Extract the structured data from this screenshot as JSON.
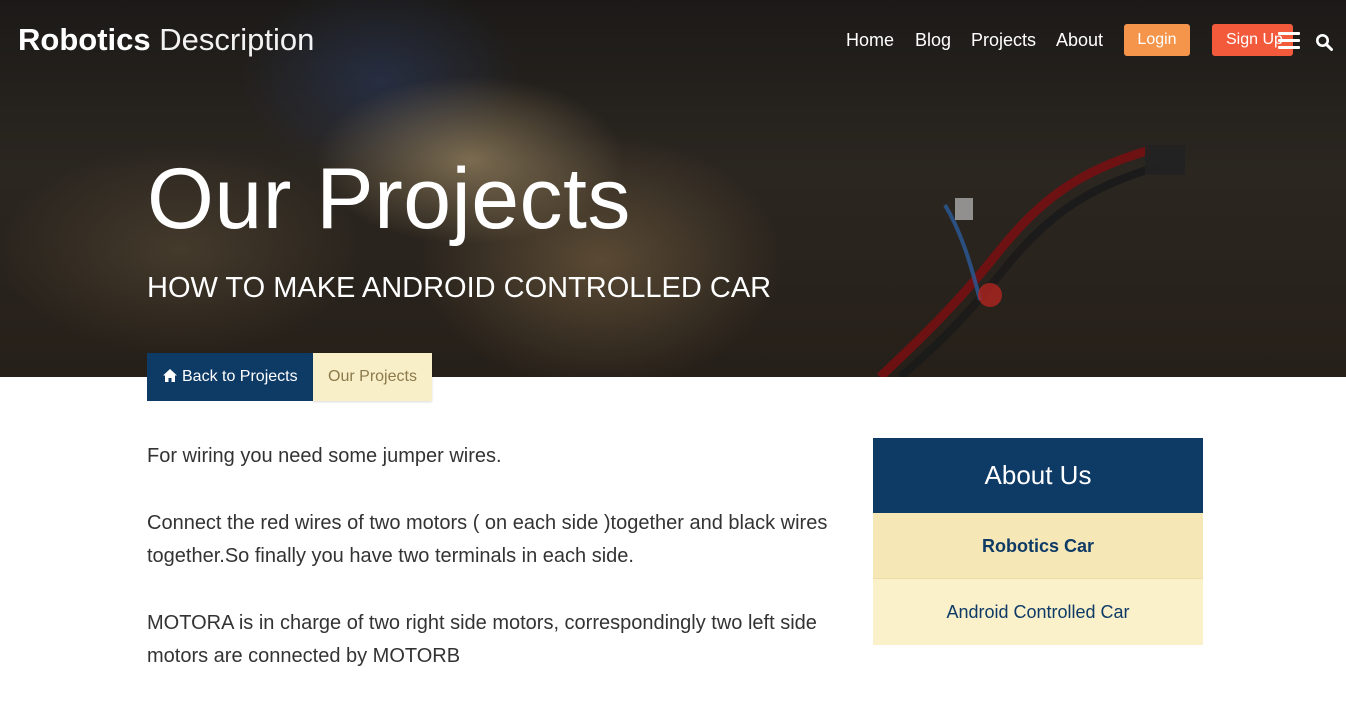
{
  "header": {
    "brand_strong": "Robotics",
    "brand_light": "Description",
    "nav": [
      {
        "label": "Home"
      },
      {
        "label": "Blog"
      },
      {
        "label": "Projects"
      },
      {
        "label": "About"
      }
    ],
    "login_label": "Login",
    "signup_label": "Sign Up",
    "menu_icon": "hamburger-menu-icon",
    "search_icon": "search-icon"
  },
  "hero": {
    "title": "Our Projects",
    "subtitle": "HOW TO MAKE ANDROID CONTROLLED CAR",
    "back_label": "Back to Projects",
    "back_icon": "home-icon",
    "current_label": "Our Projects"
  },
  "content": {
    "paragraphs": [
      "For wiring you need some jumper wires.",
      "Connect the red wires of two motors ( on each side )together and black wires together.So finally you have two terminals in each side.",
      "MOTORA is in charge of two right side motors, correspondingly two left side motors are connected by MOTORB"
    ]
  },
  "sidebar": {
    "title": "About Us",
    "items": [
      {
        "label": "Robotics Car"
      },
      {
        "label": "Android Controlled Car"
      }
    ]
  },
  "colors": {
    "primary": "#0e3a66",
    "login": "#f4954b",
    "signup": "#f35a3c",
    "sidebar_active": "#f5e7b6",
    "sidebar_item": "#faf0ca"
  }
}
